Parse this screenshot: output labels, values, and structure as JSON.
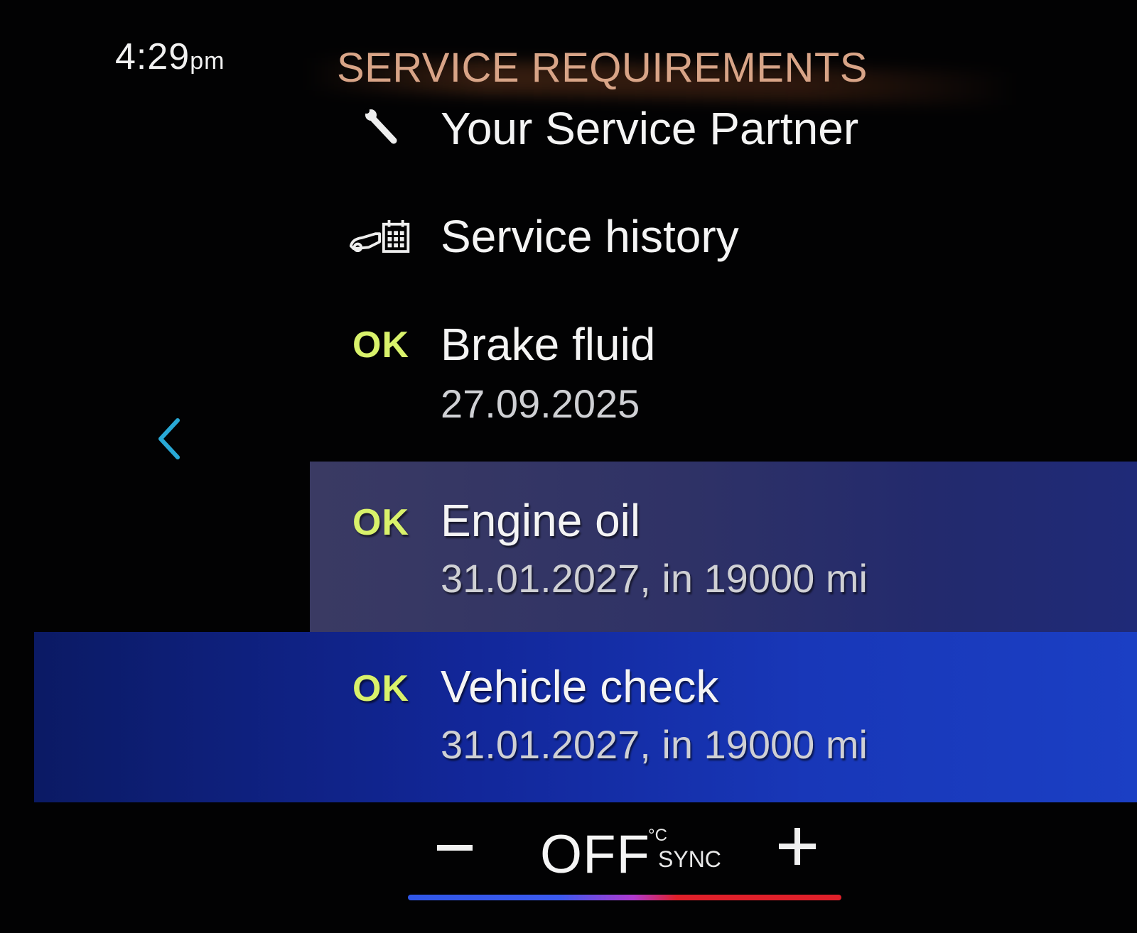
{
  "status_bar": {
    "time": "4:29",
    "ampm": "pm"
  },
  "screen_title": "SERVICE REQUIREMENTS",
  "menu": {
    "items": [
      {
        "icon": "wrench-icon",
        "label": "Your Service Partner"
      },
      {
        "icon": "service-history-icon",
        "label": "Service history"
      }
    ]
  },
  "requirements": [
    {
      "status": "OK",
      "name": "Brake fluid",
      "due": "27.09.2025"
    },
    {
      "status": "OK",
      "name": "Engine oil",
      "due": "31.01.2027, in 19000 mi",
      "selected": true
    },
    {
      "status": "OK",
      "name": "Vehicle check",
      "due": "31.01.2027, in 19000 mi"
    }
  ],
  "climate": {
    "minus_label": "–",
    "value": "OFF",
    "unit": "°C",
    "sync_label": "SYNC",
    "plus_label": "+"
  },
  "colors": {
    "title": "#d8a487",
    "ok_status": "#d9f26b",
    "back_chevron": "#29a9d6",
    "selected_row": "#2f3266",
    "highlight_row": "#1837b8"
  }
}
